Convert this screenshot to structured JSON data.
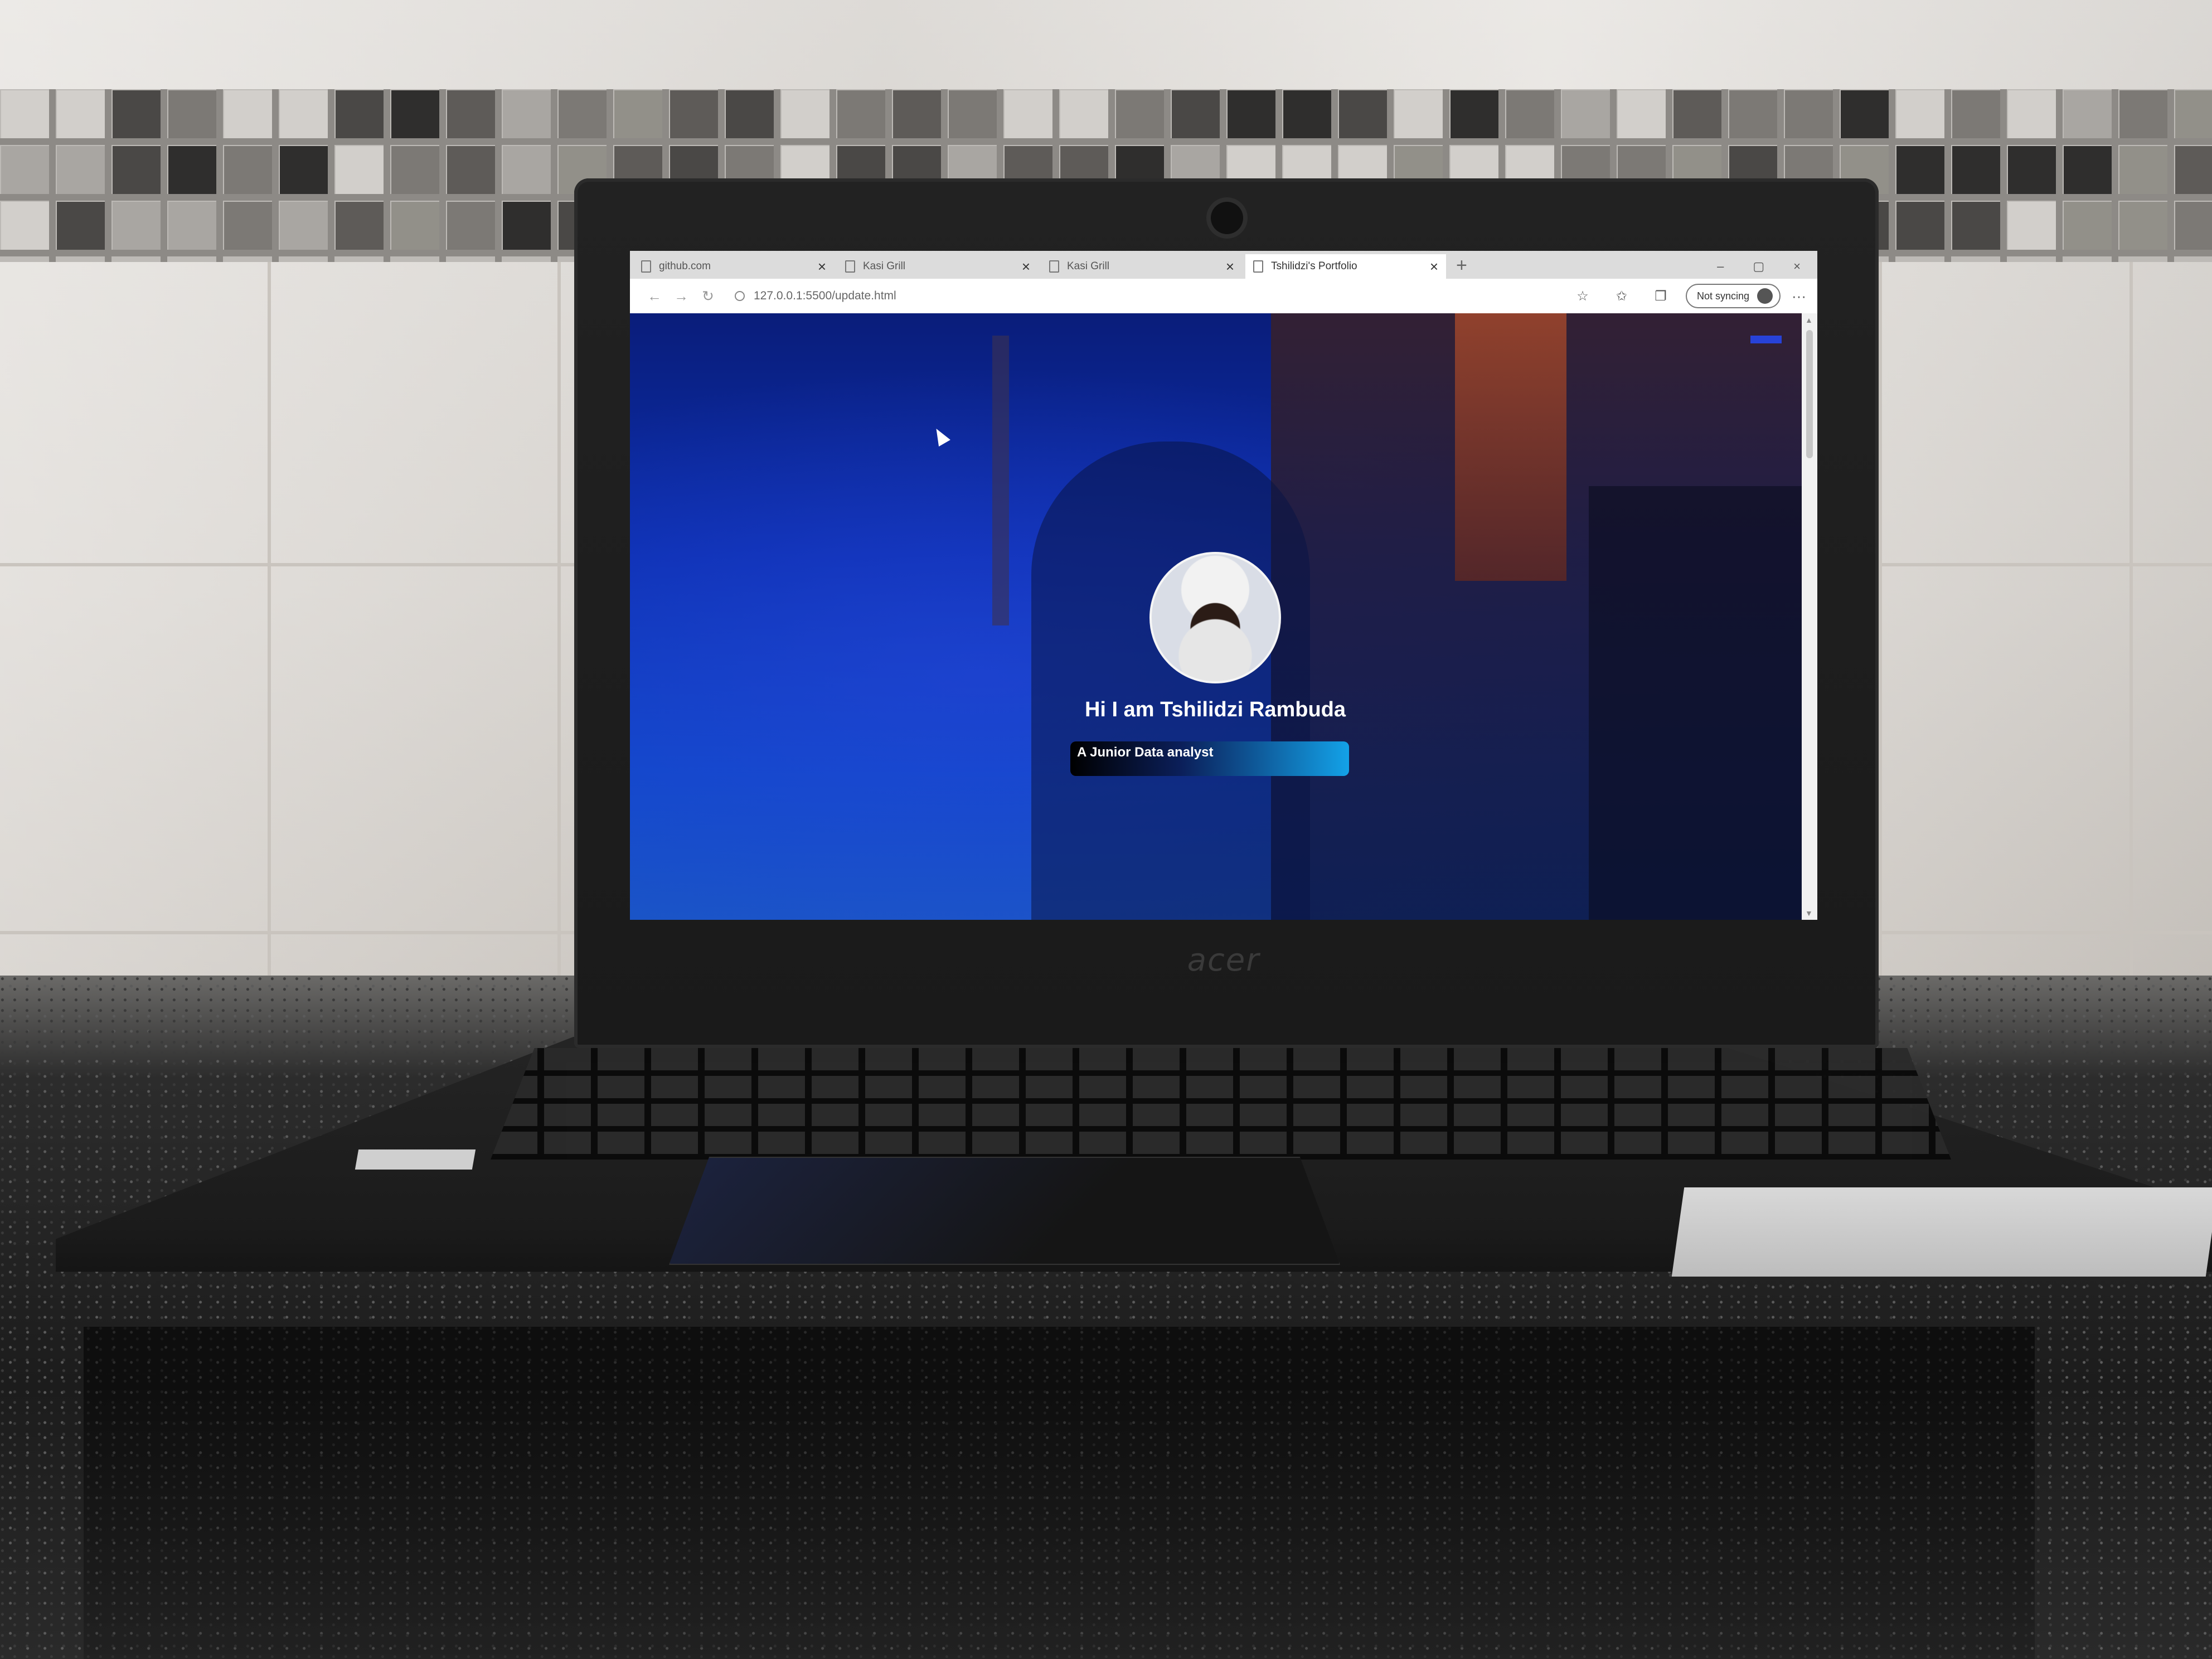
{
  "browser": {
    "tabs": [
      {
        "title": "github.com",
        "active": false
      },
      {
        "title": "Kasi Grill",
        "active": false
      },
      {
        "title": "Kasi Grill",
        "active": false
      },
      {
        "title": "Tshilidzi's Portfolio",
        "active": true
      }
    ],
    "tab_close_glyph": "×",
    "new_tab_glyph": "+",
    "window_controls": [
      "–",
      "▢",
      "×"
    ],
    "url": "127.0.0.1:5500/update.html",
    "sync_label": "Not syncing",
    "more_glyph": "···"
  },
  "page": {
    "heading": "Hi I am Tshilidzi Rambuda",
    "subtitle": "A Junior Data analyst"
  },
  "laptop": {
    "brand": "acer"
  },
  "colors": {
    "page_background": "#0b2fb0",
    "subtitle_gradient_end": "#13a2e8",
    "laptop_body": "#1b1b1b"
  },
  "icons": [
    "back-icon",
    "forward-icon",
    "refresh-icon",
    "info-icon",
    "favorite-star-icon",
    "favorites-icon",
    "collections-icon",
    "profile-icon",
    "cursor-icon"
  ]
}
